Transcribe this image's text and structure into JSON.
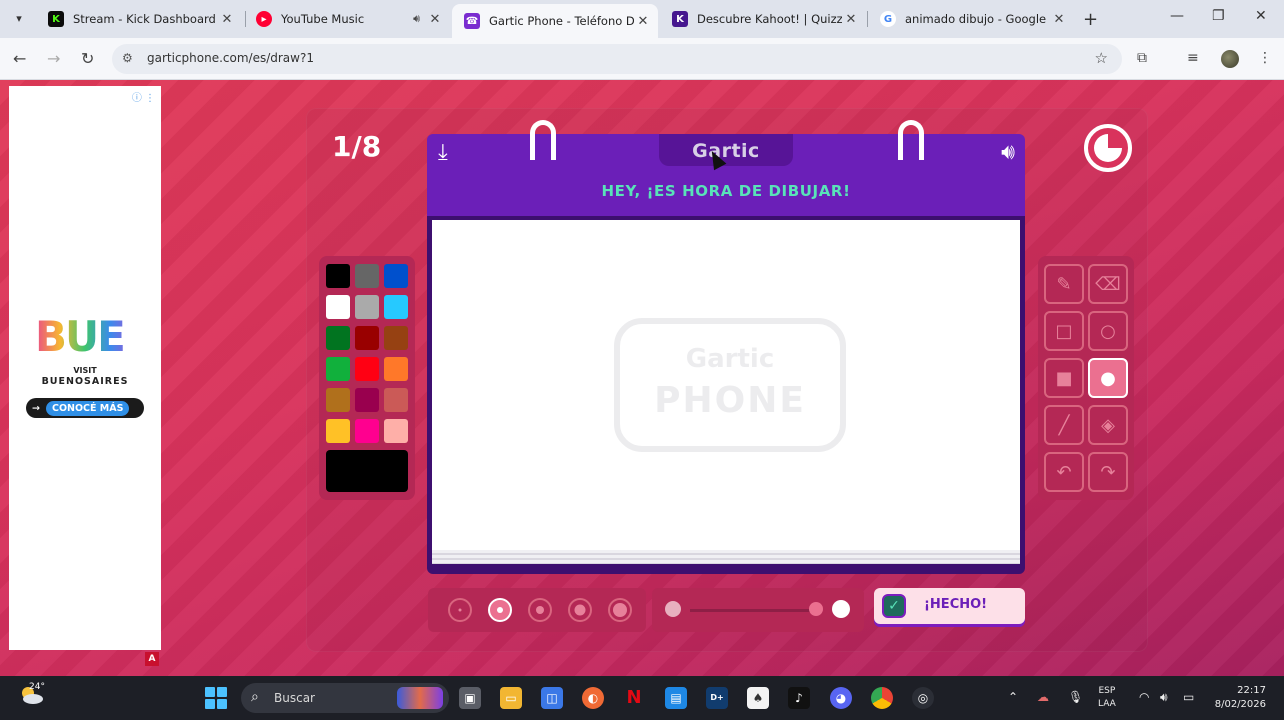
{
  "browser": {
    "tabs": [
      {
        "title": "Stream - Kick Dashboard",
        "favicon": "kick-icon",
        "color": "#53fc18"
      },
      {
        "title": "YouTube Music",
        "favicon": "youtube-music-icon",
        "color": "#ff0033"
      },
      {
        "title": "Gartic Phone - Teléfono Des",
        "favicon": "gartic-phone-icon",
        "color": "#7a2cd0"
      },
      {
        "title": "Descubre Kahoot! | Quizzes",
        "favicon": "kahoot-icon",
        "color": "#46178f"
      },
      {
        "title": "animado dibujo - Google Se",
        "favicon": "google-icon",
        "color": "#4285f4"
      }
    ],
    "url": "garticphone.com/es/draw?1"
  },
  "ad": {
    "logo": "BUE",
    "visit": "VISIT",
    "city": "BUENOSAIRES",
    "cta": "CONOCÉ MÁS",
    "badge": "A"
  },
  "game": {
    "round": "1/8",
    "brand": "Gartic",
    "instruction": "HEY, ¡ES HORA DE DIBUJAR!",
    "watermark_top": "Gartic",
    "watermark_bottom": "PHONE",
    "done_label": "¡HECHO!",
    "selected_color": "#000000",
    "palette": [
      "#000000",
      "#666666",
      "#0050cd",
      "#ffffff",
      "#aaaaaa",
      "#26c9ff",
      "#017420",
      "#990000",
      "#964112",
      "#11b03c",
      "#ff0013",
      "#ff7829",
      "#b0701c",
      "#99004e",
      "#cb5a57",
      "#ffc126",
      "#ff008f",
      "#feafa8"
    ],
    "tools": [
      "pencil-icon",
      "eraser-icon",
      "rectangle-outline-icon",
      "ellipse-outline-icon",
      "rectangle-fill-icon",
      "ellipse-fill-icon",
      "line-icon",
      "bucket-icon",
      "undo-icon",
      "redo-icon"
    ],
    "active_tool": "ellipse-fill-icon",
    "brush_sizes": [
      1,
      2,
      3,
      4,
      5
    ],
    "active_brush_size": 2
  },
  "taskbar": {
    "temperature": "24°",
    "search_placeholder": "Buscar",
    "lang_top": "ESP",
    "lang_bottom": "LAA",
    "time": "22:17",
    "date": "8/02/2026"
  }
}
